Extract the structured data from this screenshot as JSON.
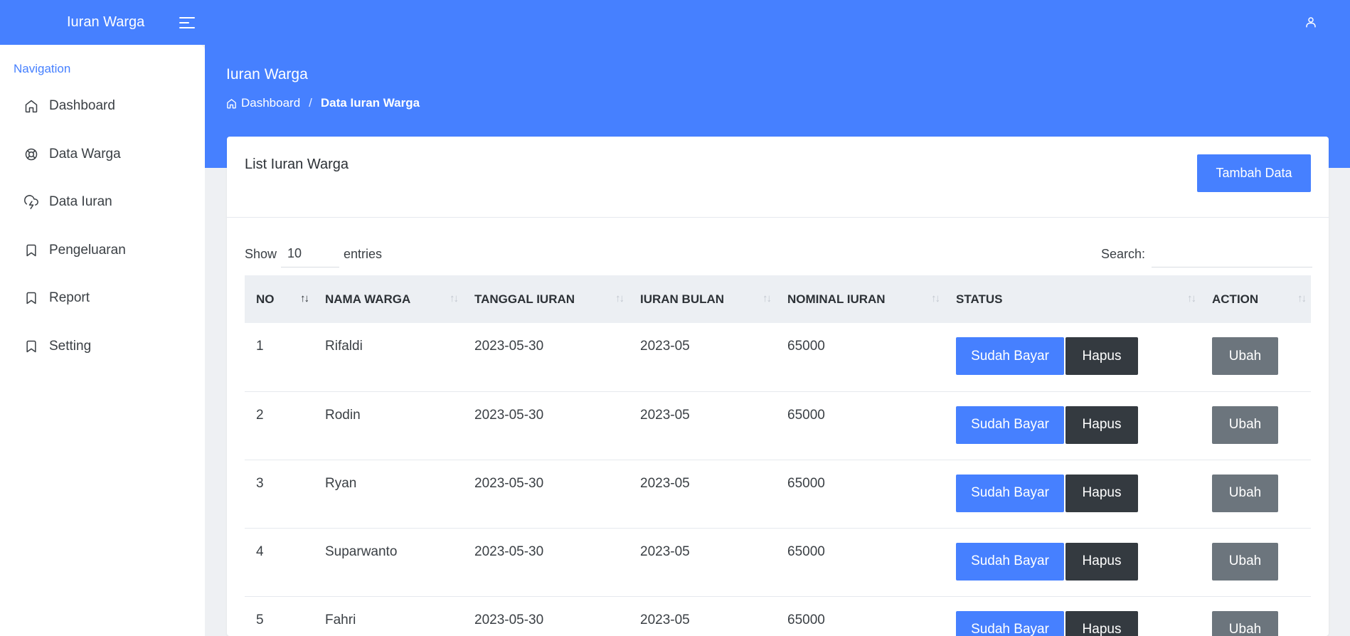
{
  "app": {
    "title": "Iuran Warga"
  },
  "colors": {
    "primary": "#4680ff",
    "dark": "#343a40",
    "secondary": "#6c757d"
  },
  "header": {
    "user_icon": "user-icon",
    "menu_icon": "menu-toggle-icon"
  },
  "page": {
    "title": "Iuran Warga",
    "breadcrumb": {
      "home_icon": "home-icon",
      "home": "Dashboard",
      "separator": "/",
      "current": "Data Iuran Warga"
    }
  },
  "sidebar": {
    "caption": "Navigation",
    "items": [
      {
        "label": "Dashboard",
        "icon": "home-icon"
      },
      {
        "label": "Data Warga",
        "icon": "lifebuoy-icon"
      },
      {
        "label": "Data Iuran",
        "icon": "cloud-lightning-icon"
      },
      {
        "label": "Pengeluaran",
        "icon": "bookmark-icon"
      },
      {
        "label": "Report",
        "icon": "bookmark-icon"
      },
      {
        "label": "Setting",
        "icon": "bookmark-icon"
      }
    ]
  },
  "card": {
    "title": "List Iuran Warga",
    "add_button": "Tambah Data",
    "show_label": "Show",
    "show_value": "10",
    "entries_label": "entries",
    "search_label": "Search:",
    "search_value": ""
  },
  "table": {
    "columns": [
      "NO",
      "NAMA WARGA",
      "TANGGAL IURAN",
      "IURAN BULAN",
      "NOMINAL IURAN",
      "STATUS",
      "ACTION"
    ],
    "sort_glyph": "↑↓",
    "rows": [
      {
        "no": "1",
        "nama": "Rifaldi",
        "tanggal": "2023-05-30",
        "bulan": "2023-05",
        "nominal": "65000",
        "status": "Sudah Bayar",
        "hapus": "Hapus",
        "ubah": "Ubah"
      },
      {
        "no": "2",
        "nama": "Rodin",
        "tanggal": "2023-05-30",
        "bulan": "2023-05",
        "nominal": "65000",
        "status": "Sudah Bayar",
        "hapus": "Hapus",
        "ubah": "Ubah"
      },
      {
        "no": "3",
        "nama": "Ryan",
        "tanggal": "2023-05-30",
        "bulan": "2023-05",
        "nominal": "65000",
        "status": "Sudah Bayar",
        "hapus": "Hapus",
        "ubah": "Ubah"
      },
      {
        "no": "4",
        "nama": "Suparwanto",
        "tanggal": "2023-05-30",
        "bulan": "2023-05",
        "nominal": "65000",
        "status": "Sudah Bayar",
        "hapus": "Hapus",
        "ubah": "Ubah"
      },
      {
        "no": "5",
        "nama": "Fahri",
        "tanggal": "2023-05-30",
        "bulan": "2023-05",
        "nominal": "65000",
        "status": "Sudah Bayar",
        "hapus": "Hapus",
        "ubah": "Ubah"
      }
    ]
  }
}
